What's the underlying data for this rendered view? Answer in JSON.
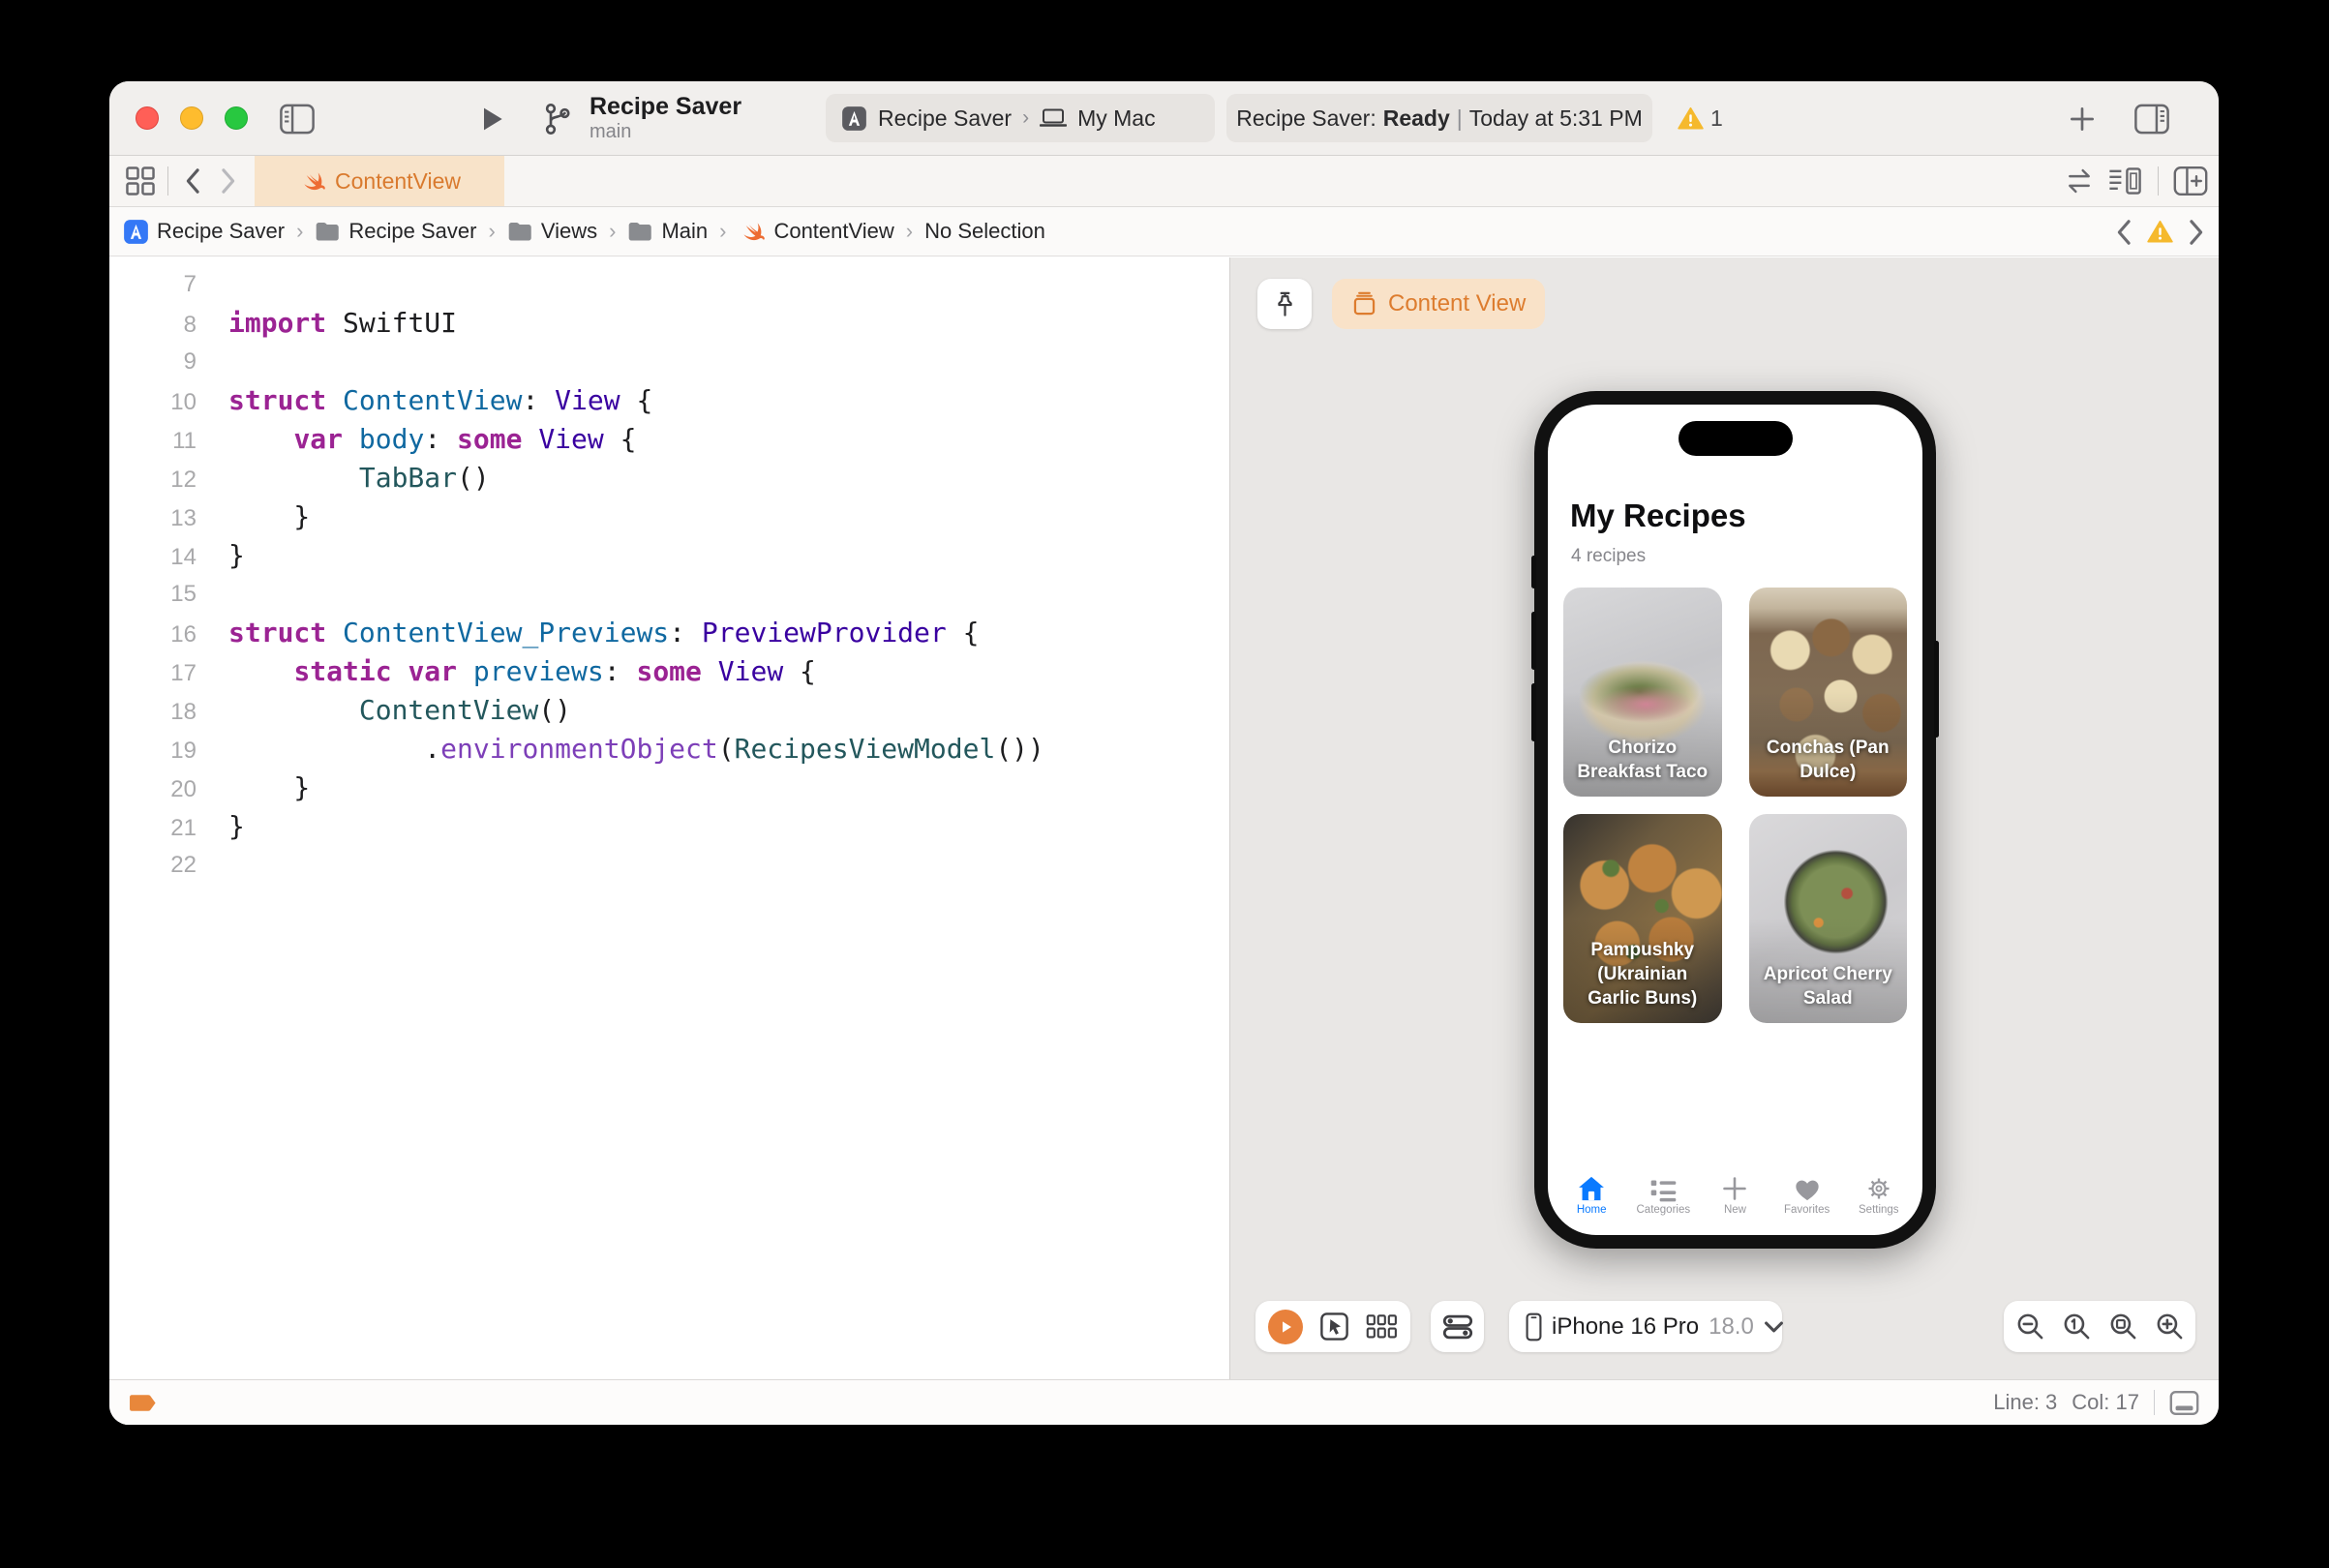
{
  "colors": {
    "accent_orange": "#DE7D2E",
    "swift_orange": "#ED6C33",
    "warning_yellow": "#F5B92D",
    "ios_blue": "#0A7AFF",
    "breakpoint_orange": "#E8873B"
  },
  "window": {
    "toolbar": {
      "project_title": "Recipe Saver",
      "branch_name": "main",
      "scheme_project": "Recipe Saver",
      "scheme_separator": "›",
      "scheme_destination": "My Mac",
      "status_project": "Recipe Saver:",
      "status_state": "Ready",
      "status_separator": "|",
      "status_time": "Today at 5:31 PM",
      "warning_count": "1"
    },
    "tab_bar": {
      "active_tab": "ContentView"
    },
    "jump_bar": {
      "separator": "›",
      "items": [
        {
          "label": "Recipe Saver",
          "icon": "app-icon-blue"
        },
        {
          "label": "Recipe Saver",
          "icon": "folder-icon"
        },
        {
          "label": "Views",
          "icon": "folder-icon"
        },
        {
          "label": "Main",
          "icon": "folder-icon"
        },
        {
          "label": "ContentView",
          "icon": "swift-icon"
        },
        {
          "label": "No Selection",
          "icon": null
        }
      ]
    },
    "editor": {
      "code_lines": [
        {
          "num": "7",
          "tokens": []
        },
        {
          "num": "8",
          "tokens": [
            {
              "t": "import",
              "c": "kw"
            },
            {
              "t": " SwiftUI",
              "c": "pl"
            }
          ]
        },
        {
          "num": "9",
          "tokens": []
        },
        {
          "num": "10",
          "tokens": [
            {
              "t": "struct",
              "c": "kw"
            },
            {
              "t": " ",
              "c": "pl"
            },
            {
              "t": "ContentView",
              "c": "decl"
            },
            {
              "t": ": ",
              "c": "pl"
            },
            {
              "t": "View",
              "c": "type"
            },
            {
              "t": " {",
              "c": "pl"
            }
          ]
        },
        {
          "num": "11",
          "tokens": [
            {
              "t": "    ",
              "c": "pl"
            },
            {
              "t": "var",
              "c": "kw"
            },
            {
              "t": " ",
              "c": "pl"
            },
            {
              "t": "body",
              "c": "decl"
            },
            {
              "t": ": ",
              "c": "pl"
            },
            {
              "t": "some",
              "c": "kw"
            },
            {
              "t": " ",
              "c": "pl"
            },
            {
              "t": "View",
              "c": "type"
            },
            {
              "t": " {",
              "c": "pl"
            }
          ]
        },
        {
          "num": "12",
          "tokens": [
            {
              "t": "        ",
              "c": "pl"
            },
            {
              "t": "TabBar",
              "c": "proj"
            },
            {
              "t": "()",
              "c": "pl"
            }
          ]
        },
        {
          "num": "13",
          "tokens": [
            {
              "t": "    }",
              "c": "pl"
            }
          ]
        },
        {
          "num": "14",
          "tokens": [
            {
              "t": "}",
              "c": "pl"
            }
          ]
        },
        {
          "num": "15",
          "tokens": []
        },
        {
          "num": "16",
          "tokens": [
            {
              "t": "struct",
              "c": "kw"
            },
            {
              "t": " ",
              "c": "pl"
            },
            {
              "t": "ContentView_Previews",
              "c": "decl"
            },
            {
              "t": ": ",
              "c": "pl"
            },
            {
              "t": "PreviewProvider",
              "c": "type"
            },
            {
              "t": " {",
              "c": "pl"
            }
          ]
        },
        {
          "num": "17",
          "tokens": [
            {
              "t": "    ",
              "c": "pl"
            },
            {
              "t": "static",
              "c": "kw"
            },
            {
              "t": " ",
              "c": "pl"
            },
            {
              "t": "var",
              "c": "kw"
            },
            {
              "t": " ",
              "c": "pl"
            },
            {
              "t": "previews",
              "c": "decl"
            },
            {
              "t": ": ",
              "c": "pl"
            },
            {
              "t": "some",
              "c": "kw"
            },
            {
              "t": " ",
              "c": "pl"
            },
            {
              "t": "View",
              "c": "type"
            },
            {
              "t": " {",
              "c": "pl"
            }
          ]
        },
        {
          "num": "18",
          "tokens": [
            {
              "t": "        ",
              "c": "pl"
            },
            {
              "t": "ContentView",
              "c": "proj"
            },
            {
              "t": "()",
              "c": "pl"
            }
          ]
        },
        {
          "num": "19",
          "tokens": [
            {
              "t": "            .",
              "c": "pl"
            },
            {
              "t": "environmentObject",
              "c": "meth"
            },
            {
              "t": "(",
              "c": "pl"
            },
            {
              "t": "RecipesViewModel",
              "c": "proj"
            },
            {
              "t": "())",
              "c": "pl"
            }
          ]
        },
        {
          "num": "20",
          "tokens": [
            {
              "t": "    }",
              "c": "pl"
            }
          ]
        },
        {
          "num": "21",
          "tokens": [
            {
              "t": "}",
              "c": "pl"
            }
          ]
        },
        {
          "num": "22",
          "tokens": []
        }
      ]
    },
    "canvas": {
      "preview_name": "Content View",
      "device_bar": {
        "device_name": "iPhone 16 Pro",
        "os_version": "18.0"
      },
      "phone": {
        "screen_title": "My Recipes",
        "screen_subtitle": "4 recipes",
        "recipes": [
          {
            "name": "Chorizo Breakfast Taco",
            "image": "chorizo-taco"
          },
          {
            "name": "Conchas (Pan Dulce)",
            "image": "conchas"
          },
          {
            "name": "Pampushky (Ukrainian Garlic Buns)",
            "image": "pampushky"
          },
          {
            "name": "Apricot Cherry Salad",
            "image": "apricot-salad"
          }
        ],
        "tab_items": [
          {
            "label": "Home",
            "icon": "home-icon",
            "active": true
          },
          {
            "label": "Categories",
            "icon": "categories-icon",
            "active": false
          },
          {
            "label": "New",
            "icon": "new-icon",
            "active": false
          },
          {
            "label": "Favorites",
            "icon": "favorites-icon",
            "active": false
          },
          {
            "label": "Settings",
            "icon": "settings-icon",
            "active": false
          }
        ]
      }
    },
    "status_bar": {
      "line": "Line: 3",
      "col": "Col: 17"
    }
  }
}
